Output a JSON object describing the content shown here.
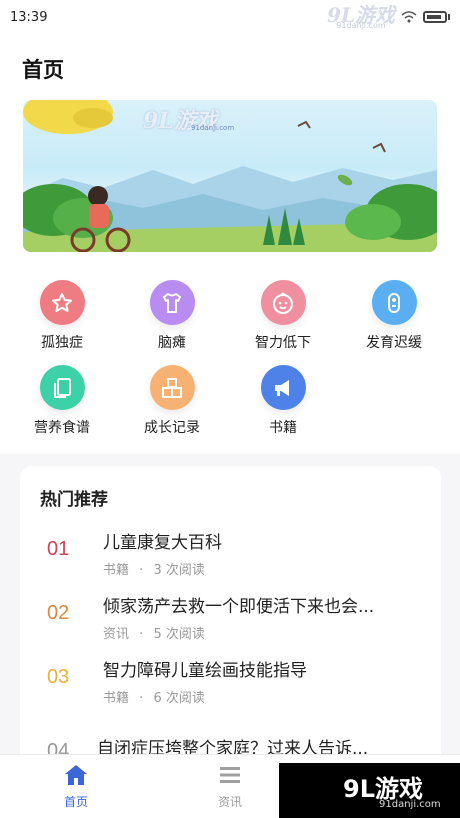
{
  "status_bar": {
    "time": "13:39",
    "watermark_logo": "9L游戏",
    "watermark_url": "91danji.com"
  },
  "header": {
    "title": "首页"
  },
  "banner": {
    "watermark_logo": "9L游戏",
    "watermark_url": "91danji.com"
  },
  "categories": [
    {
      "label": "孤独症",
      "icon": "star-icon",
      "color": "#f07c83"
    },
    {
      "label": "脑瘫",
      "icon": "shirt-icon",
      "color": "#b88cf0"
    },
    {
      "label": "智力低下",
      "icon": "baby-face-icon",
      "color": "#f08fa0"
    },
    {
      "label": "发育迟缓",
      "icon": "pacifier-icon",
      "color": "#5aaef2"
    },
    {
      "label": "营养食谱",
      "icon": "recipe-icon",
      "color": "#3dd1a7"
    },
    {
      "label": "成长记录",
      "icon": "blocks-icon",
      "color": "#f7b173"
    },
    {
      "label": "书籍",
      "icon": "megaphone-icon",
      "color": "#4f82e8"
    }
  ],
  "hot": {
    "title": "热门推荐",
    "items": [
      {
        "num": "01",
        "num_color": "#d24555",
        "name": "儿童康复大百科",
        "type": "书籍",
        "dot": "·",
        "reads": "3 次阅读"
      },
      {
        "num": "02",
        "num_color": "#e2883a",
        "name": "倾家荡产去救一个即便活下来也会...",
        "type": "资讯",
        "dot": "·",
        "reads": "5 次阅读"
      },
      {
        "num": "03",
        "num_color": "#e8b237",
        "name": "智力障碍儿童绘画技能指导",
        "type": "书籍",
        "dot": "·",
        "reads": "6 次阅读"
      },
      {
        "num": "04",
        "num_color": "#9a9a9a",
        "name": "自闭症压垮整个家庭？过来人告诉...",
        "type": "",
        "dot": "",
        "reads": ""
      }
    ]
  },
  "tabs": [
    {
      "label": "首页",
      "icon": "home-icon",
      "active": true
    },
    {
      "label": "资讯",
      "icon": "list-icon",
      "active": false
    }
  ],
  "bottom_watermark": {
    "logo": "9L游戏",
    "url": "91danji.com"
  },
  "colors": {
    "active_tab": "#3a66d8",
    "inactive_tab": "#a0a0a0"
  }
}
